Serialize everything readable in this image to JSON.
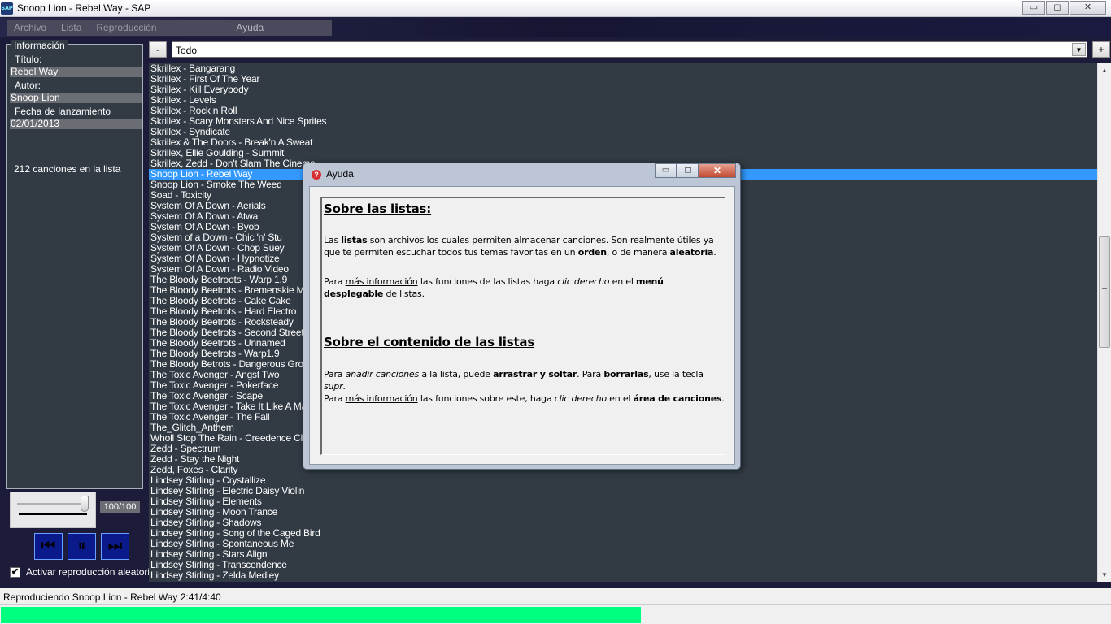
{
  "window": {
    "title": "Snoop Lion - Rebel Way - SAP",
    "icon_text": "SAP",
    "minimize": "▭",
    "maximize": "◻",
    "close": "✕"
  },
  "menu": [
    "Archivo",
    "Lista",
    "Reproducción",
    "",
    "Ayuda",
    ""
  ],
  "info": {
    "legend": "Información",
    "title_label": "Título:",
    "title_value": "Rebel Way",
    "author_label": "Autor:",
    "author_value": "Snoop Lion",
    "date_label": "Fecha de lanzamiento",
    "date_value": "02/01/2013",
    "count_text": "212 canciones en la lista"
  },
  "volume": {
    "label": "100/100",
    "level": 1.0
  },
  "controls": {
    "prev": "⏮",
    "pause": "⏸",
    "next": "⏭"
  },
  "shuffle": {
    "checked": true,
    "label": "Activar reproducción aleatoria",
    "check_glyph": "✔"
  },
  "list_controls": {
    "remove_label": "-",
    "add_label": "+",
    "selected_list": "Todo",
    "arrow": "▼"
  },
  "songs": [
    "Skrillex - Bangarang",
    "Skrillex - First Of The Year",
    "Skrillex - Kill Everybody",
    "Skrillex - Levels",
    "Skrillex - Rock n Roll",
    "Skrillex - Scary Monsters And Nice Sprites",
    "Skrillex - Syndicate",
    "Skrillex & The Doors - Break'n A Sweat",
    "Skrillex, Ellie Goulding - Summit",
    "Skrillex, Zedd - Don't Slam The Cinema",
    "Snoop Lion - Rebel Way",
    "Snoop Lion - Smoke The Weed",
    "Soad - Toxicity",
    "System Of A Down - Aerials",
    "System Of A Down - Atwa",
    "System Of A Down - Byob",
    "System of a Down - Chic 'n' Stu",
    "System Of A Down - Chop Suey",
    "System Of A Down - Hypnotize",
    "System Of A Down - Radio Video",
    "The Bloody Beetroots - Warp 1.9",
    "The Bloody Beetrots - Bremenskie Muzik",
    "The Bloody Beetrots - Cake Cake",
    "The Bloody Beetrots - Hard Electro",
    "The Bloody Beetrots - Rocksteady",
    "The Bloody Beetrots - Second Streets H",
    "The Bloody Beetrots - Unnamed",
    "The Bloody Beetrots - Warp1.9",
    "The Bloody Betrots - Dangerous Group",
    "The Toxic Avenger - Angst Two",
    "The Toxic Avenger - Pokerface",
    "The Toxic Avenger - Scape",
    "The Toxic Avenger - Take It Like A Man",
    "The Toxic Avenger - The Fall",
    "The_Glitch_Anthem",
    "Wholl Stop The Rain - Creedence Clear",
    "Zedd - Spectrum",
    "Zedd - Stay the Night",
    "Zedd, Foxes - Clarity",
    "Lindsey Stirling - Crystallize",
    "Lindsey Stirling - Electric Daisy Violin",
    "Lindsey Stirling - Elements",
    "Lindsey Stirling - Moon Trance",
    "Lindsey Stirling - Shadows",
    "Lindsey Stirling - Song of the Caged Bird",
    "Lindsey Stirling - Spontaneous Me",
    "Lindsey Stirling - Stars Align",
    "Lindsey Stirling - Transcendence",
    "Lindsey Stirling - Zelda Medley"
  ],
  "selected_index": 10,
  "scrollbar": {
    "up": "▲",
    "down": "▼"
  },
  "status": {
    "text": "Reproduciendo Snoop Lion - Rebel Way  2:41/4:40",
    "progress": 0.576
  },
  "dialog": {
    "title": "Ayuda",
    "icon_text": "?",
    "min": "▭",
    "max": "◻",
    "close": "✕",
    "h1": "Sobre las listas:",
    "h2": "Sobre el contenido de las listas",
    "p1": {
      "a": "Las ",
      "b": "listas",
      "c": " son archivos los cuales permiten almacenar canciones. Son realmente útiles ya que te permiten escuchar todos tus temas favoritas en un ",
      "d": "orden",
      "e": ", o de manera ",
      "f": "aleatoria",
      "g": "."
    },
    "p2": {
      "a": "Para ",
      "b": "más información",
      "c": " las funciones  de las listas haga ",
      "d": "clic derecho",
      "e": " en el ",
      "f": "menú desplegable",
      "g": " de listas."
    },
    "p3": {
      "a": "Para ",
      "b": "añadir canciones",
      "c": " a la lista, puede ",
      "d": "arrastrar y soltar",
      "e": ". Para ",
      "f": "borrarlas",
      "g": ", use la tecla ",
      "h": "supr",
      "i": "."
    },
    "p4": {
      "a": "Para ",
      "b": "más información",
      "c": " las funciones sobre este, haga ",
      "d": "clic derecho",
      "e": " en el ",
      "f": "área de canciones",
      "g": "."
    }
  }
}
